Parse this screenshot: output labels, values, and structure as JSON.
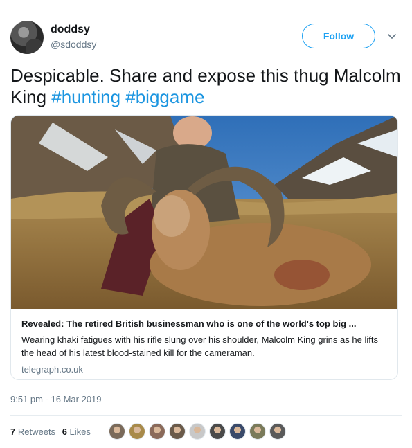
{
  "user": {
    "display_name": "doddsy",
    "handle": "@sdoddsy",
    "avatar_icon": "profile-photo"
  },
  "follow_button": {
    "label": "Follow"
  },
  "menu": {
    "icon": "chevron-down-icon"
  },
  "tweet": {
    "text_part1": "Despicable. Share and expose this thug Malcolm King ",
    "hashtags": [
      "#hunting",
      "#biggame"
    ]
  },
  "card": {
    "image_icon": "article-photo",
    "title": "Revealed: The retired British businessman who is one of the world's top big ...",
    "description": "Wearing khaki fatigues with his rifle slung over his shoulder, Malcolm King grins as he lifts the head of his latest blood-stained kill for the cameraman.",
    "domain": "telegraph.co.uk"
  },
  "timestamp": "9:51 pm - 16 Mar 2019",
  "stats": {
    "retweets_count": "7",
    "retweets_label": "Retweets",
    "likes_count": "6",
    "likes_label": "Likes"
  },
  "likers": [
    {
      "color": "#7a6a5a"
    },
    {
      "color": "#a88a4a"
    },
    {
      "color": "#8a6a5a"
    },
    {
      "color": "#6a5a4a"
    },
    {
      "color": "#c8c8c8"
    },
    {
      "color": "#4a4a4a"
    },
    {
      "color": "#3a4a6a"
    },
    {
      "color": "#7a7a5a"
    },
    {
      "color": "#5a5a5a"
    }
  ],
  "colors": {
    "accent": "#1da1f2",
    "hashtag": "#1b95e0",
    "secondary_text": "#657786"
  }
}
